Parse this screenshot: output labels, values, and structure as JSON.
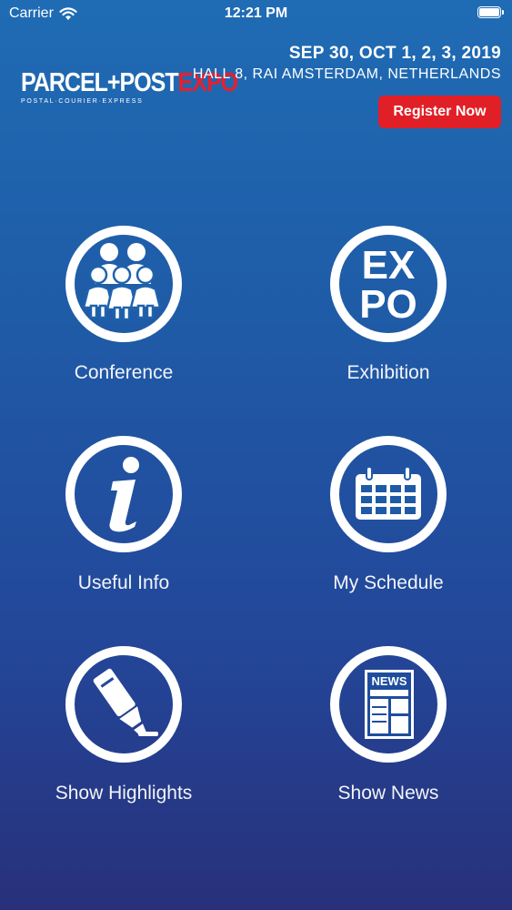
{
  "status_bar": {
    "carrier": "Carrier",
    "time": "12:21 PM"
  },
  "header": {
    "logo": {
      "parcel_post": "PARCEL+POST",
      "expo": "EXPO",
      "tagline": "POSTAL·COURIER·EXPRESS"
    },
    "event_dates": "SEP 30, OCT 1, 2, 3, 2019",
    "venue": "HALL 8, RAI AMSTERDAM, NETHERLANDS",
    "register_label": "Register Now"
  },
  "menu": [
    {
      "label": "Conference",
      "icon": "people-group-icon"
    },
    {
      "label": "Exhibition",
      "icon": "expo-icon"
    },
    {
      "label": "Useful Info",
      "icon": "info-icon"
    },
    {
      "label": "My Schedule",
      "icon": "calendar-icon"
    },
    {
      "label": "Show Highlights",
      "icon": "highlighter-icon"
    },
    {
      "label": "Show News",
      "icon": "newspaper-icon"
    }
  ],
  "icon_text": {
    "expo_top": "EX",
    "expo_bottom": "PO",
    "news": "NEWS"
  },
  "colors": {
    "accent_red": "#e11f26",
    "background_top": "#1f6cb4",
    "background_bottom": "#28307a"
  }
}
